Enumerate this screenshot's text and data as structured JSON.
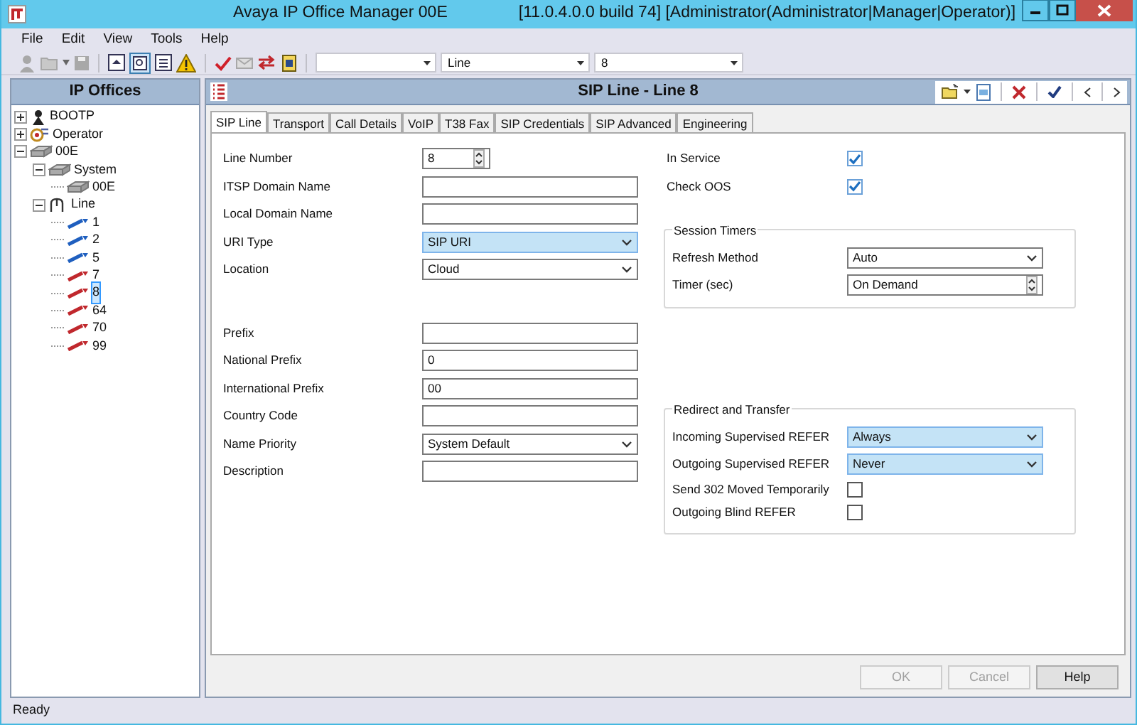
{
  "window": {
    "title": "Avaya IP Office Manager 00E",
    "subtitle": "[11.0.4.0.0 build 74] [Administrator(Administrator|Manager|Operator)]"
  },
  "menu": [
    "File",
    "Edit",
    "View",
    "Tools",
    "Help"
  ],
  "toolbar": {
    "combos": [
      {
        "value": "Line"
      },
      {
        "value": "8"
      }
    ]
  },
  "tree": {
    "title": "IP Offices",
    "items": [
      {
        "label": "BOOTP",
        "kind": "bootp",
        "expanded": false,
        "selected": false
      },
      {
        "label": "Operator",
        "kind": "operator",
        "expanded": false,
        "selected": false
      },
      {
        "label": "00E",
        "kind": "system",
        "expanded": true,
        "selected": false,
        "children": [
          {
            "label": "System",
            "kind": "system",
            "expanded": true,
            "selected": false,
            "children": [
              {
                "label": "00E",
                "kind": "system",
                "selected": false
              }
            ]
          },
          {
            "label": "Line",
            "kind": "line",
            "expanded": true,
            "selected": false,
            "children": [
              {
                "label": "1",
                "kind": "trunk",
                "color": "#1f5fbf",
                "selected": false
              },
              {
                "label": "2",
                "kind": "trunk",
                "color": "#1f5fbf",
                "selected": false
              },
              {
                "label": "5",
                "kind": "trunk",
                "color": "#1f5fbf",
                "selected": false
              },
              {
                "label": "7",
                "kind": "trunk",
                "color": "#c0282d",
                "selected": false
              },
              {
                "label": "8",
                "kind": "trunk",
                "color": "#c0282d",
                "selected": true
              },
              {
                "label": "64",
                "kind": "trunk",
                "color": "#c0282d",
                "selected": false
              },
              {
                "label": "70",
                "kind": "trunk",
                "color": "#c0282d",
                "selected": false
              },
              {
                "label": "99",
                "kind": "trunk",
                "color": "#c0282d",
                "selected": false
              }
            ]
          }
        ]
      }
    ]
  },
  "panel": {
    "title": "SIP Line - Line 8",
    "tabs": [
      {
        "label": "SIP Line",
        "selected": true
      },
      {
        "label": "Transport",
        "selected": false
      },
      {
        "label": "Call Details",
        "selected": false
      },
      {
        "label": "VoIP",
        "selected": false
      },
      {
        "label": "T38 Fax",
        "selected": false
      },
      {
        "label": "SIP Credentials",
        "selected": false
      },
      {
        "label": "SIP Advanced",
        "selected": false
      },
      {
        "label": "Engineering",
        "selected": false
      }
    ],
    "field_groups": [
      [
        {
          "label": "Line Number",
          "kind": "spin",
          "value": "8",
          "highlighted": false
        },
        {
          "label": "ITSP Domain Name",
          "kind": "text",
          "highlighted": false
        },
        {
          "label": "Local Domain Name",
          "kind": "text",
          "highlighted": false
        },
        {
          "label": "URI Type",
          "kind": "select",
          "value": "SIP URI",
          "highlighted": true
        },
        {
          "label": "Location",
          "kind": "select",
          "value": "Cloud",
          "highlighted": false
        }
      ],
      [
        {
          "label": "Prefix",
          "kind": "text",
          "highlighted": false
        },
        {
          "label": "National Prefix",
          "kind": "text",
          "value": "0",
          "highlighted": false
        },
        {
          "label": "International Prefix",
          "kind": "text",
          "value": "00",
          "highlighted": false
        },
        {
          "label": "Country Code",
          "kind": "text",
          "highlighted": false
        },
        {
          "label": "Name Priority",
          "kind": "select",
          "value": "System Default",
          "highlighted": false
        },
        {
          "label": "Description",
          "kind": "text",
          "highlighted": false
        }
      ]
    ],
    "checks": [
      {
        "label": "In Service",
        "checked": true
      },
      {
        "label": "Check OOS",
        "checked": true
      }
    ],
    "session_timers": {
      "title": "Session Timers",
      "rows": [
        {
          "label": "Refresh Method",
          "kind": "select",
          "value": "Auto",
          "highlighted": false
        },
        {
          "label": "Timer (sec)",
          "kind": "spin",
          "value": "On Demand",
          "highlighted": false
        }
      ]
    },
    "redirect": {
      "title": "Redirect and Transfer",
      "rows": [
        {
          "label": "Incoming Supervised REFER",
          "kind": "select",
          "value": "Always",
          "highlighted": true
        },
        {
          "label": "Outgoing Supervised REFER",
          "kind": "select",
          "value": "Never",
          "highlighted": true
        },
        {
          "label": "Send 302 Moved Temporarily",
          "kind": "checkbox",
          "checked": false
        },
        {
          "label": "Outgoing Blind REFER",
          "kind": "checkbox",
          "checked": false
        }
      ]
    },
    "buttons": [
      {
        "label": "OK",
        "disabled": true
      },
      {
        "label": "Cancel",
        "disabled": true
      },
      {
        "label": "Help",
        "disabled": false
      }
    ]
  },
  "status_bar": "Ready"
}
